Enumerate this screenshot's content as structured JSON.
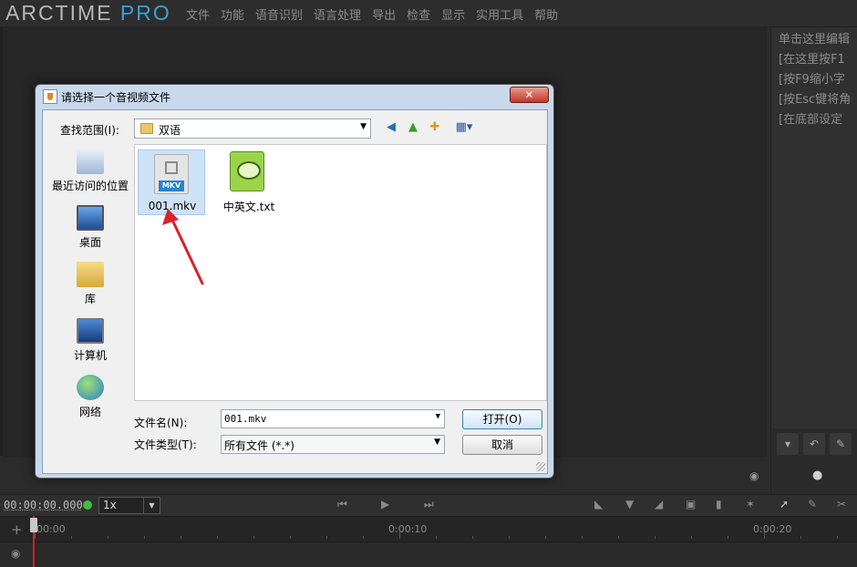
{
  "app": {
    "logo_main": "ARCTIME",
    "logo_pro": "PRO",
    "menu": [
      "文件",
      "功能",
      "语音识别",
      "语言处理",
      "导出",
      "检查",
      "显示",
      "实用工具",
      "帮助"
    ]
  },
  "right_panel": {
    "lines": [
      "单击这里编辑",
      "[在这里按F1",
      "[按F9缩小字",
      "[按Esc键将角",
      "[在底部设定"
    ]
  },
  "transport": {
    "timecode": "00:00:00.000",
    "speed": "1x"
  },
  "timeline": {
    "labels": [
      "00:00",
      "0:00:10",
      "0:00:20"
    ]
  },
  "dialog": {
    "title": "请选择一个音视频文件",
    "close_label": "✕",
    "look_in_label": "查找范围(I):",
    "look_in_value": "双语",
    "places": [
      {
        "label": "最近访问的位置"
      },
      {
        "label": "桌面"
      },
      {
        "label": "库"
      },
      {
        "label": "计算机"
      },
      {
        "label": "网络"
      }
    ],
    "files": [
      {
        "name": "001.mkv",
        "badge": "MKV",
        "selected": true
      },
      {
        "name": "中英文.txt",
        "selected": false
      }
    ],
    "file_name_label": "文件名(N):",
    "file_name_value": "001.mkv",
    "file_type_label": "文件类型(T):",
    "file_type_value": "所有文件 (*.*)",
    "open_label": "打开(O)",
    "cancel_label": "取消"
  },
  "colors": {
    "accent_blue": "#3aa0d8",
    "playhead_red": "#d82020",
    "status_green": "#3cbf3c",
    "annotation_arrow": "#d9232b"
  }
}
